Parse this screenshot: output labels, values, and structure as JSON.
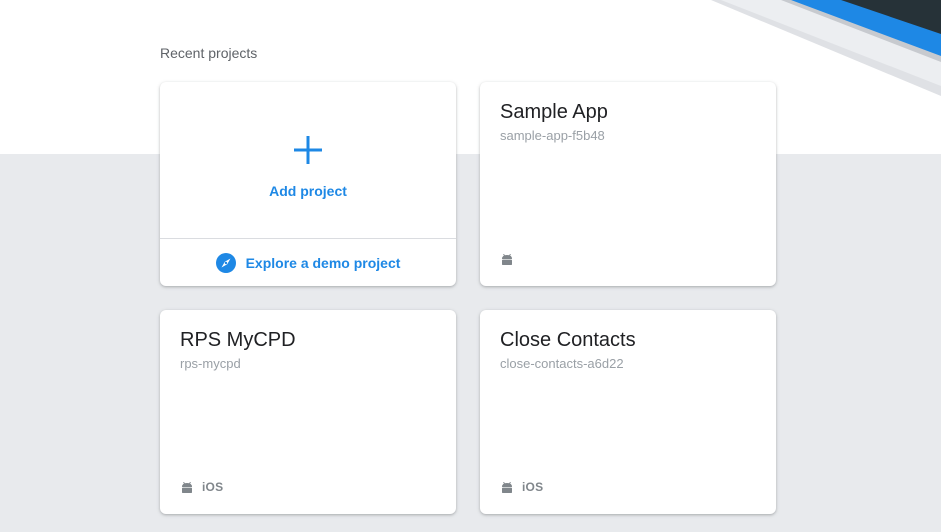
{
  "section": {
    "title": "Recent projects"
  },
  "add_card": {
    "label": "Add project",
    "demo_label": "Explore a demo project"
  },
  "projects": [
    {
      "name": "Sample App",
      "id": "sample-app-f5b48",
      "platforms": [
        "android"
      ]
    },
    {
      "name": "RPS MyCPD",
      "id": "rps-mycpd",
      "platforms": [
        "android",
        "iOS"
      ],
      "ios_label": "iOS"
    },
    {
      "name": "Close Contacts",
      "id": "close-contacts-a6d22",
      "platforms": [
        "android",
        "iOS"
      ],
      "ios_label": "iOS"
    }
  ],
  "colors": {
    "accent": "#1e88e5",
    "page_bg": "#e8eaed",
    "top_bg": "#ffffff"
  }
}
